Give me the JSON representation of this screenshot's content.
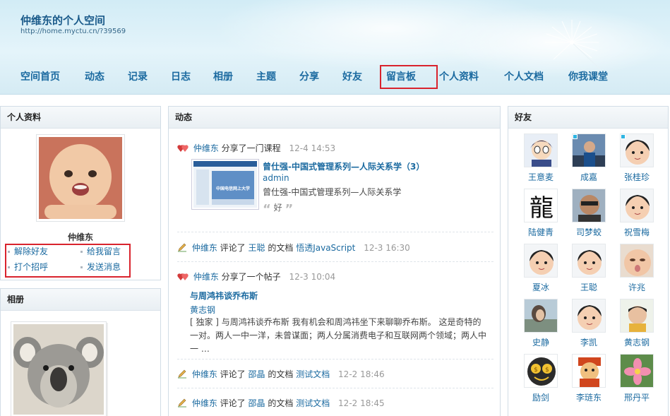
{
  "header": {
    "title": "仲维东的个人空间",
    "url": "http://home.myctu.cn/?39569"
  },
  "nav": [
    {
      "label": "空间首页"
    },
    {
      "label": "动态"
    },
    {
      "label": "记录"
    },
    {
      "label": "日志"
    },
    {
      "label": "相册"
    },
    {
      "label": "主题"
    },
    {
      "label": "分享"
    },
    {
      "label": "好友"
    },
    {
      "label": "留言板"
    },
    {
      "label": "个人资料"
    },
    {
      "label": "个人文档"
    },
    {
      "label": "你我课堂"
    }
  ],
  "profile": {
    "heading": "个人资料",
    "name": "仲维东",
    "actions": [
      "解除好友",
      "给我留言",
      "打个招呼",
      "发送消息"
    ]
  },
  "album": {
    "heading": "相册"
  },
  "feed": {
    "heading": "动态",
    "items": [
      {
        "user": "仲维东",
        "verb": "分享了一门课程",
        "time": "12-4 14:53",
        "title": "曾仕强-中国式管理系列—人际关系学（3）",
        "author": "admin",
        "desc": "曾仕强-中国式管理系列—人际关系学",
        "quote": "好",
        "thumb_text": "中国电信网上大学"
      },
      {
        "user": "仲维东",
        "verb1": "评论了",
        "target_user": "王聪",
        "verb2": "的文档",
        "doc": "悟透JavaScript",
        "time": "12-3 16:30"
      },
      {
        "user": "仲维东",
        "verb": "分享了一个帖子",
        "time": "12-3 10:04",
        "title": "与周鸿祎谈乔布斯",
        "author": "黄志钢",
        "body": "[ 独家 ] 与周鸿祎谈乔布斯 我有机会和周鸿祎坐下来聊聊乔布斯。 这是奇特的一对。两人一中一洋，未曾谋面；两人分属消费电子和互联网两个领域；两人中一 …"
      },
      {
        "user": "仲维东",
        "verb1": "评论了",
        "target_user": "邵晶",
        "verb2": "的文档",
        "doc": "测试文档",
        "time": "12-2 18:46"
      },
      {
        "user": "仲维东",
        "verb1": "评论了",
        "target_user": "邵晶",
        "verb2": "的文档",
        "doc": "测试文档",
        "time": "12-2 18:45"
      }
    ]
  },
  "friends": {
    "heading": "好友",
    "list": [
      {
        "name": "王意麦"
      },
      {
        "name": "成嘉"
      },
      {
        "name": "张桂珍"
      },
      {
        "name": "陆健青"
      },
      {
        "name": "司梦蛟"
      },
      {
        "name": "祝雪梅"
      },
      {
        "name": "夏冰"
      },
      {
        "name": "王聪"
      },
      {
        "name": "许兆"
      },
      {
        "name": "史静"
      },
      {
        "name": "李凯"
      },
      {
        "name": "黄志钢"
      },
      {
        "name": "励剑"
      },
      {
        "name": "李琏东"
      },
      {
        "name": "邢丹平"
      }
    ]
  },
  "colors": {
    "link": "#1b6aa0",
    "highlight": "#d9232d"
  }
}
